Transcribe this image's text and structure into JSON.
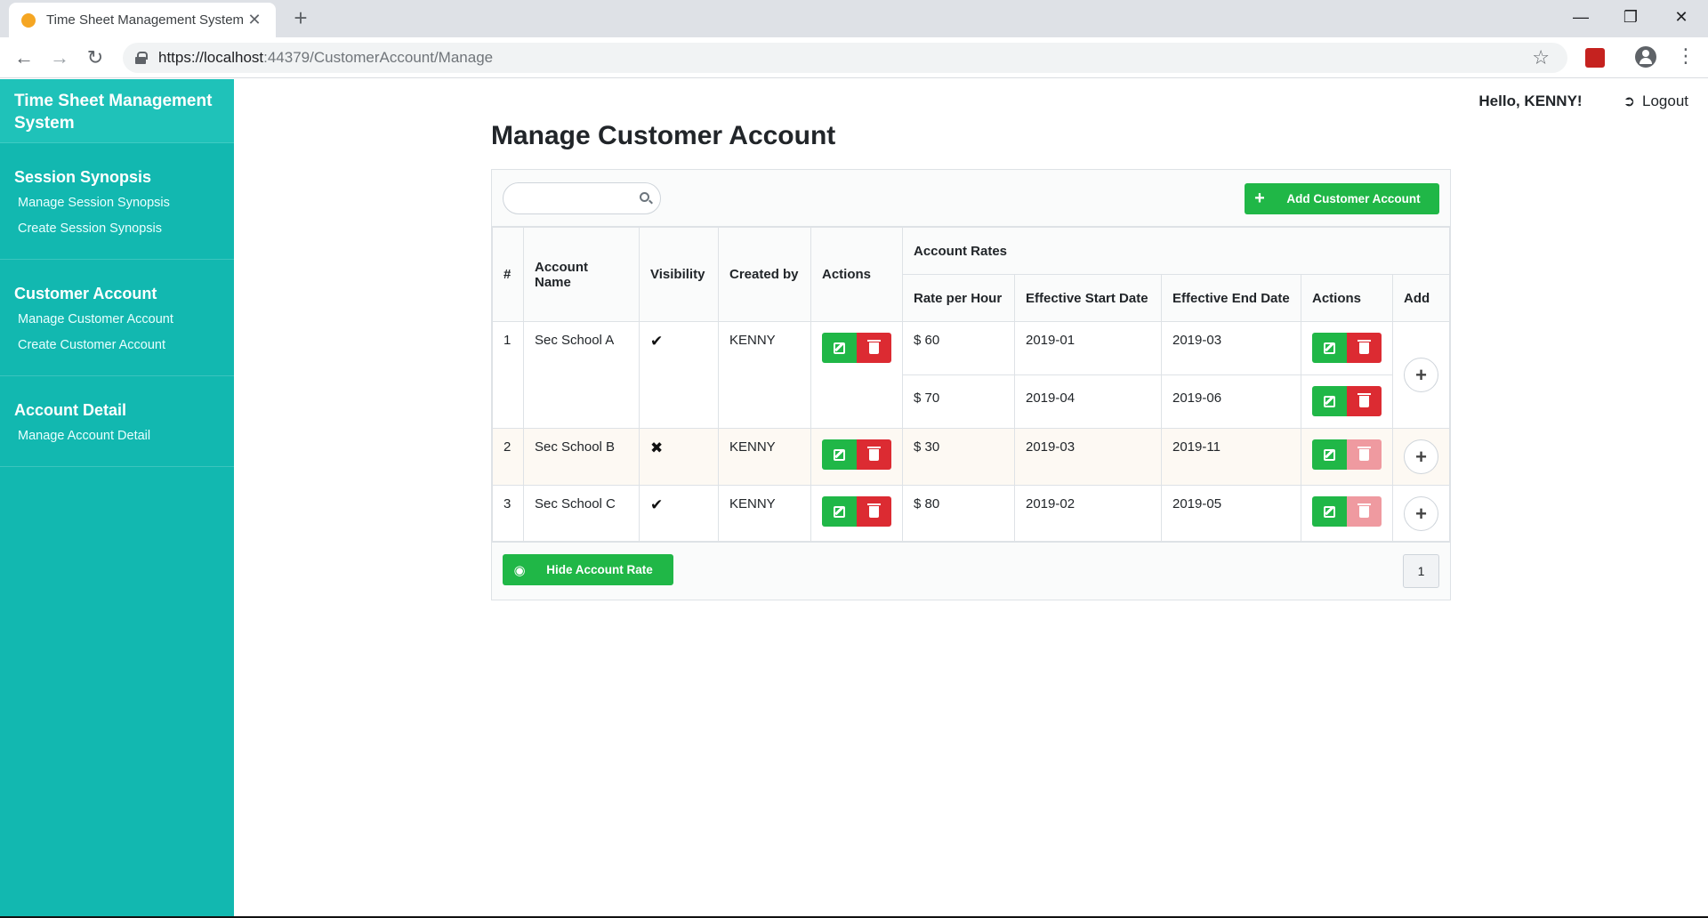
{
  "browser": {
    "tab_title": "Time Sheet Management System",
    "tab_close": "✕",
    "new_tab": "+",
    "url_host": "https://localhost",
    "url_rest": ":44379/CustomerAccount/Manage",
    "minimize": "—",
    "restore": "❐",
    "close": "✕"
  },
  "sidebar": {
    "brand": "Time Sheet Management System",
    "sections": [
      {
        "title": "Session Synopsis",
        "links": [
          "Manage Session Synopsis",
          "Create Session Synopsis"
        ]
      },
      {
        "title": "Customer Account",
        "links": [
          "Manage Customer Account",
          "Create Customer Account"
        ]
      },
      {
        "title": "Account Detail",
        "links": [
          "Manage Account Detail"
        ]
      }
    ]
  },
  "header": {
    "greeting": "Hello, KENNY!",
    "logout": "Logout"
  },
  "page": {
    "title": "Manage Customer Account",
    "search_placeholder": "",
    "add_button": "Add Customer Account",
    "hide_button": "Hide Account Rate",
    "page_number": "1"
  },
  "table": {
    "headers": {
      "num": "#",
      "account_name": "Account Name",
      "visibility": "Visibility",
      "created_by": "Created by",
      "actions": "Actions",
      "account_rates": "Account Rates",
      "rate_per_hour": "Rate per Hour",
      "start_date": "Effective Start Date",
      "end_date": "Effective End Date",
      "rate_actions": "Actions",
      "add": "Add"
    },
    "rows": [
      {
        "num": "1",
        "name": "Sec School A",
        "visible": "✔",
        "created_by": "KENNY",
        "rates": [
          {
            "rate": "$ 60",
            "start": "2019-01",
            "end": "2019-03"
          },
          {
            "rate": "$ 70",
            "start": "2019-04",
            "end": "2019-06"
          }
        ]
      },
      {
        "num": "2",
        "name": "Sec School B",
        "visible": "✖",
        "created_by": "KENNY",
        "rates": [
          {
            "rate": "$ 30",
            "start": "2019-03",
            "end": "2019-11"
          }
        ]
      },
      {
        "num": "3",
        "name": "Sec School C",
        "visible": "✔",
        "created_by": "KENNY",
        "rates": [
          {
            "rate": "$ 80",
            "start": "2019-02",
            "end": "2019-05"
          }
        ]
      }
    ]
  },
  "colors": {
    "sidebar": "#12b8b0",
    "brand": "#1fc2b9",
    "success": "#20b747",
    "danger": "#dc2b32"
  }
}
